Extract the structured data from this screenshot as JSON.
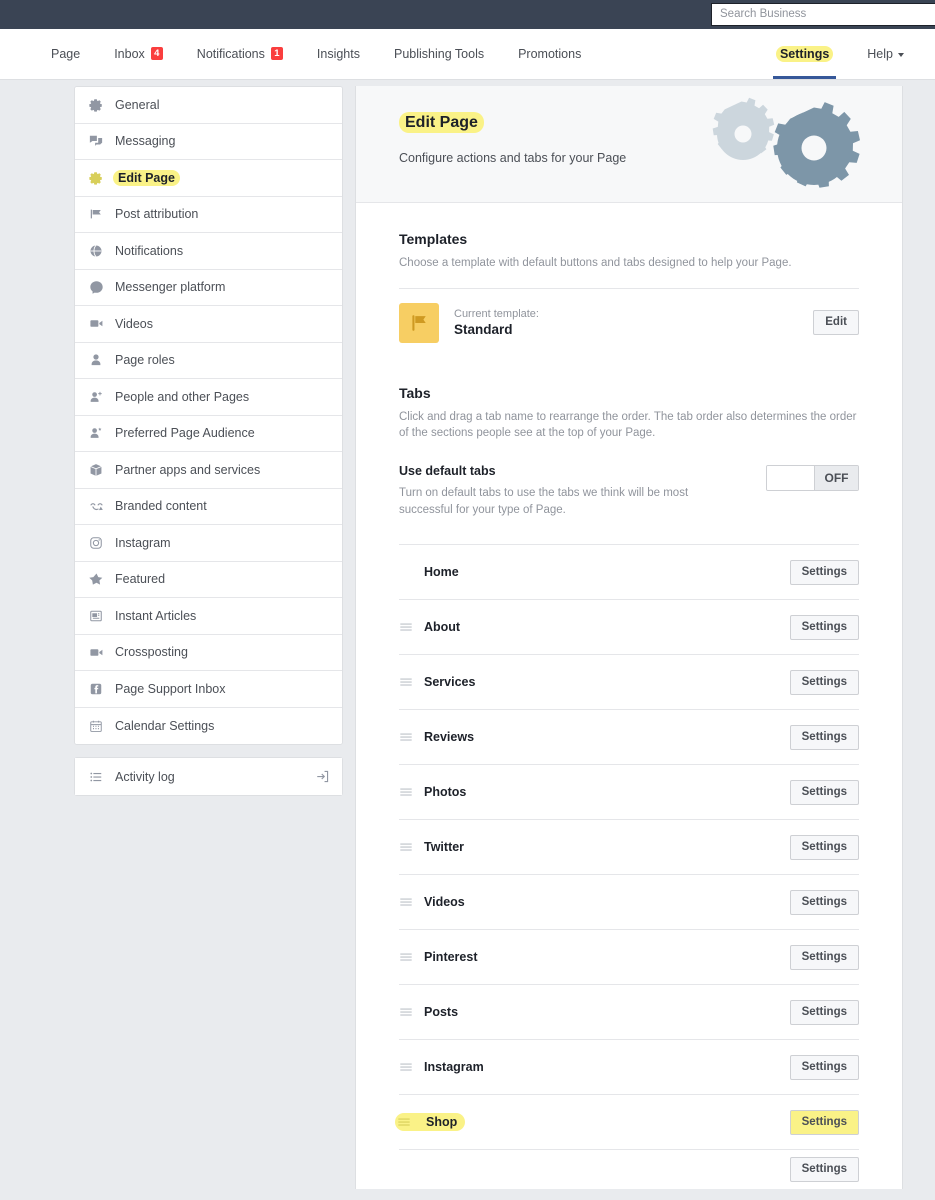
{
  "topbar": {
    "search": {
      "placeholder": "Search Business",
      "value": "",
      "icon": "search-icon"
    }
  },
  "nav": {
    "items": [
      {
        "label": "Page",
        "badge": null
      },
      {
        "label": "Inbox",
        "badge": "4"
      },
      {
        "label": "Notifications",
        "badge": "1"
      },
      {
        "label": "Insights",
        "badge": null
      },
      {
        "label": "Publishing Tools",
        "badge": null
      },
      {
        "label": "Promotions",
        "badge": null
      }
    ],
    "right": [
      {
        "label": "Settings",
        "active": true,
        "highlighted": true
      },
      {
        "label": "Help",
        "active": false,
        "caret": true
      }
    ]
  },
  "sidebar": {
    "items": [
      {
        "label": "General",
        "icon": "gear-icon",
        "selected": false
      },
      {
        "label": "Messaging",
        "icon": "chat-bubbles-icon",
        "selected": false
      },
      {
        "label": "Edit Page",
        "icon": "gear-icon",
        "selected": true
      },
      {
        "label": "Post attribution",
        "icon": "flag-icon",
        "selected": false
      },
      {
        "label": "Notifications",
        "icon": "globe-icon",
        "selected": false
      },
      {
        "label": "Messenger platform",
        "icon": "messenger-icon",
        "selected": false
      },
      {
        "label": "Videos",
        "icon": "video-camera-icon",
        "selected": false
      },
      {
        "label": "Page roles",
        "icon": "person-icon",
        "selected": false
      },
      {
        "label": "People and other Pages",
        "icon": "person-add-icon",
        "selected": false
      },
      {
        "label": "Preferred Page Audience",
        "icon": "person-star-icon",
        "selected": false
      },
      {
        "label": "Partner apps and services",
        "icon": "box-icon",
        "selected": false
      },
      {
        "label": "Branded content",
        "icon": "branded-content-icon",
        "selected": false
      },
      {
        "label": "Instagram",
        "icon": "instagram-icon",
        "selected": false
      },
      {
        "label": "Featured",
        "icon": "star-icon",
        "selected": false
      },
      {
        "label": "Instant Articles",
        "icon": "instant-articles-icon",
        "selected": false
      },
      {
        "label": "Crossposting",
        "icon": "video-camera-icon",
        "selected": false
      },
      {
        "label": "Page Support Inbox",
        "icon": "facebook-icon",
        "selected": false
      },
      {
        "label": "Calendar Settings",
        "icon": "calendar-icon",
        "selected": false
      }
    ],
    "activity_log": {
      "label": "Activity log",
      "icon": "list-icon",
      "action_icon": "open-external-icon"
    }
  },
  "main": {
    "header": {
      "title": "Edit Page",
      "subtitle": "Configure actions and tabs for your Page",
      "graphic": "gears-illustration"
    },
    "templates": {
      "title": "Templates",
      "description": "Choose a template with default buttons and tabs designed to help your Page.",
      "current_label": "Current template:",
      "current_name": "Standard",
      "edit_button": "Edit",
      "icon": "flag-template-icon",
      "icon_bg": "#f7ce63"
    },
    "tabs_section": {
      "title": "Tabs",
      "description": "Click and drag a tab name to rearrange the order. The tab order also determines the order of the sections people see at the top of your Page.",
      "default_tabs": {
        "title": "Use default tabs",
        "description": "Turn on default tabs to use the tabs we think will be most successful for your type of Page.",
        "toggle_state": "OFF"
      },
      "settings_button": "Settings",
      "rows": [
        {
          "label": "Home",
          "draggable": false,
          "highlighted": false
        },
        {
          "label": "About",
          "draggable": true,
          "highlighted": false
        },
        {
          "label": "Services",
          "draggable": true,
          "highlighted": false
        },
        {
          "label": "Reviews",
          "draggable": true,
          "highlighted": false
        },
        {
          "label": "Photos",
          "draggable": true,
          "highlighted": false
        },
        {
          "label": "Twitter",
          "draggable": true,
          "highlighted": false
        },
        {
          "label": "Videos",
          "draggable": true,
          "highlighted": false
        },
        {
          "label": "Pinterest",
          "draggable": true,
          "highlighted": false
        },
        {
          "label": "Posts",
          "draggable": true,
          "highlighted": false
        },
        {
          "label": "Instagram",
          "draggable": true,
          "highlighted": false
        },
        {
          "label": "Shop",
          "draggable": true,
          "highlighted": true
        }
      ]
    }
  },
  "colors": {
    "topbar_bg": "#3a4454",
    "page_bg": "#e9ebee",
    "accent_blue": "#365899",
    "badge_red": "#fa3e3e",
    "highlight_yellow": "#faf287",
    "template_icon_bg": "#f7ce63"
  }
}
